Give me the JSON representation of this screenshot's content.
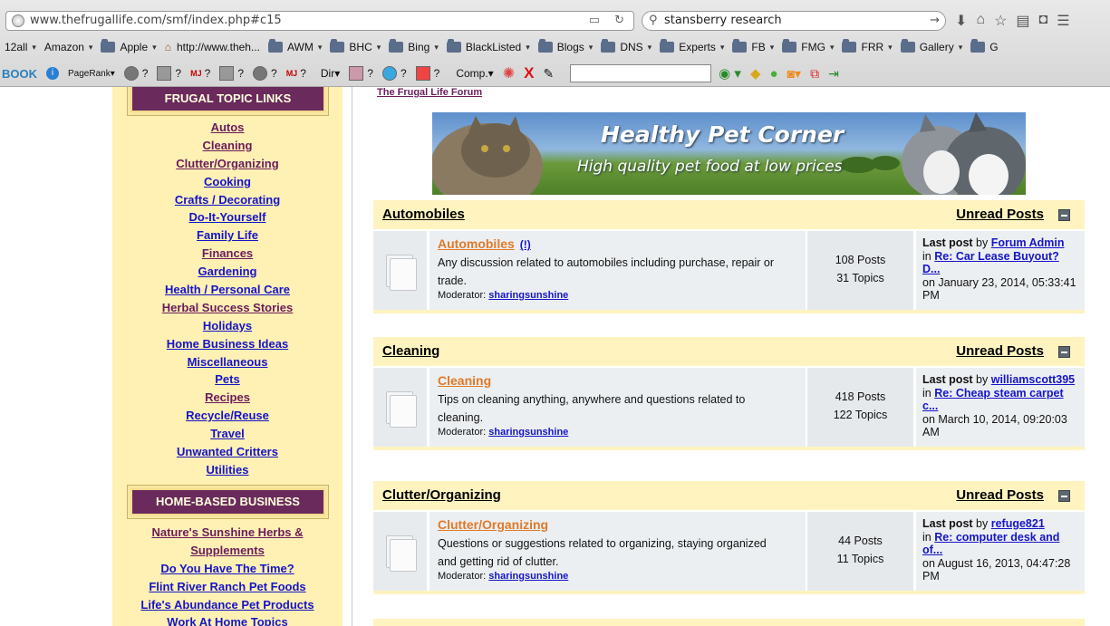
{
  "browser": {
    "url": "www.thefrugallife.com/smf/index.php#c15",
    "search_query": "stansberry research",
    "bookmarks": [
      {
        "label": "12all",
        "folder": false,
        "menu": true
      },
      {
        "label": "Amazon",
        "folder": false,
        "menu": true
      },
      {
        "label": "Apple",
        "folder": true,
        "menu": true
      },
      {
        "label": "http://www.theh...",
        "folder": false,
        "menu": false
      },
      {
        "label": "AWM",
        "folder": true,
        "menu": true
      },
      {
        "label": "BHC",
        "folder": true,
        "menu": true
      },
      {
        "label": "Bing",
        "folder": true,
        "menu": true
      },
      {
        "label": "BlackListed",
        "folder": true,
        "menu": true
      },
      {
        "label": "Blogs",
        "folder": true,
        "menu": true
      },
      {
        "label": "DNS",
        "folder": true,
        "menu": true
      },
      {
        "label": "Experts",
        "folder": true,
        "menu": true
      },
      {
        "label": "FB",
        "folder": true,
        "menu": true
      },
      {
        "label": "FMG",
        "folder": true,
        "menu": true
      },
      {
        "label": "FRR",
        "folder": true,
        "menu": true
      },
      {
        "label": "Gallery",
        "folder": true,
        "menu": true
      },
      {
        "label": "G",
        "folder": true,
        "menu": false
      }
    ],
    "toolbar": {
      "book_label": "BOOK",
      "pagerank_label": "PageRank",
      "question": "?",
      "mj_label": "MJ",
      "dir_label": "Dir",
      "comp_label": "Comp."
    }
  },
  "sidebar": {
    "topics_header": "FRUGAL TOPIC LINKS",
    "topics": [
      {
        "label": "Autos",
        "color": "purple"
      },
      {
        "label": "Cleaning",
        "color": "purple"
      },
      {
        "label": "Clutter/Organizing",
        "color": "purple"
      },
      {
        "label": "Cooking",
        "color": "blue"
      },
      {
        "label": "Crafts / Decorating",
        "color": "blue"
      },
      {
        "label": "Do-It-Yourself",
        "color": "blue"
      },
      {
        "label": "Family Life",
        "color": "blue"
      },
      {
        "label": "Finances",
        "color": "purple"
      },
      {
        "label": "Gardening",
        "color": "blue"
      },
      {
        "label": "Health / Personal Care",
        "color": "blue"
      },
      {
        "label": "Herbal Success Stories",
        "color": "purple"
      },
      {
        "label": "Holidays",
        "color": "blue"
      },
      {
        "label": "Home Business Ideas",
        "color": "blue"
      },
      {
        "label": "Miscellaneous",
        "color": "blue"
      },
      {
        "label": "Pets",
        "color": "blue"
      },
      {
        "label": "Recipes",
        "color": "purple"
      },
      {
        "label": "Recycle/Reuse",
        "color": "blue"
      },
      {
        "label": "Travel",
        "color": "blue"
      },
      {
        "label": "Unwanted Critters",
        "color": "blue"
      },
      {
        "label": "Utilities",
        "color": "blue"
      }
    ],
    "business_header": "HOME-BASED BUSINESS",
    "business": [
      {
        "label": "Nature's Sunshine Herbs &",
        "color": "purple"
      },
      {
        "label": "Supplements",
        "color": "purple"
      },
      {
        "label": "Do You Have The Time?",
        "color": "blue"
      },
      {
        "label": "Flint River Ranch Pet Foods",
        "color": "blue"
      },
      {
        "label": "Life's Abundance Pet Products",
        "color": "blue"
      },
      {
        "label": "Work At Home Topics",
        "color": "blue"
      }
    ]
  },
  "main": {
    "forum_title": "The Frugal Life Forum",
    "banner": {
      "title": "Healthy Pet Corner",
      "subtitle": "High quality pet food at low prices"
    },
    "unread_label": "Unread Posts",
    "categories": [
      {
        "name": "Automobiles",
        "board": {
          "name": "Automobiles",
          "new_marker": "(!)",
          "desc_1": "Any discussion related to automobiles including purchase, repair or",
          "desc_2": "trade.",
          "moderator_label": "Moderator:",
          "moderator": "sharingsunshine",
          "posts": "108 Posts",
          "topics": "31 Topics",
          "last_label": "Last post",
          "by": "by",
          "last_by": "Forum Admin",
          "in": "in",
          "last_subject": "Re: Car Lease Buyout? D...",
          "last_on": "on January 23, 2014, 05:33:41 PM"
        }
      },
      {
        "name": "Cleaning",
        "board": {
          "name": "Cleaning",
          "new_marker": "",
          "desc_1": "Tips on cleaning anything, anywhere and questions related to",
          "desc_2": "cleaning.",
          "moderator_label": "Moderator:",
          "moderator": "sharingsunshine",
          "posts": "418 Posts",
          "topics": "122 Topics",
          "last_label": "Last post",
          "by": "by",
          "last_by": "williamscott395",
          "in": "in",
          "last_subject": "Re: Cheap steam carpet c...",
          "last_on": "on March 10, 2014, 09:20:03 AM"
        }
      },
      {
        "name": "Clutter/Organizing",
        "board": {
          "name": "Clutter/Organizing",
          "new_marker": "",
          "desc_1": "Questions or suggestions related to organizing, staying organized",
          "desc_2": "and getting rid of clutter.",
          "moderator_label": "Moderator:",
          "moderator": "sharingsunshine",
          "posts": "44 Posts",
          "topics": "11 Topics",
          "last_label": "Last post",
          "by": "by",
          "last_by": "refuge821",
          "in": "in",
          "last_subject": "Re: computer desk and of...",
          "last_on": "on August 16, 2013, 04:47:28 PM"
        }
      }
    ]
  }
}
